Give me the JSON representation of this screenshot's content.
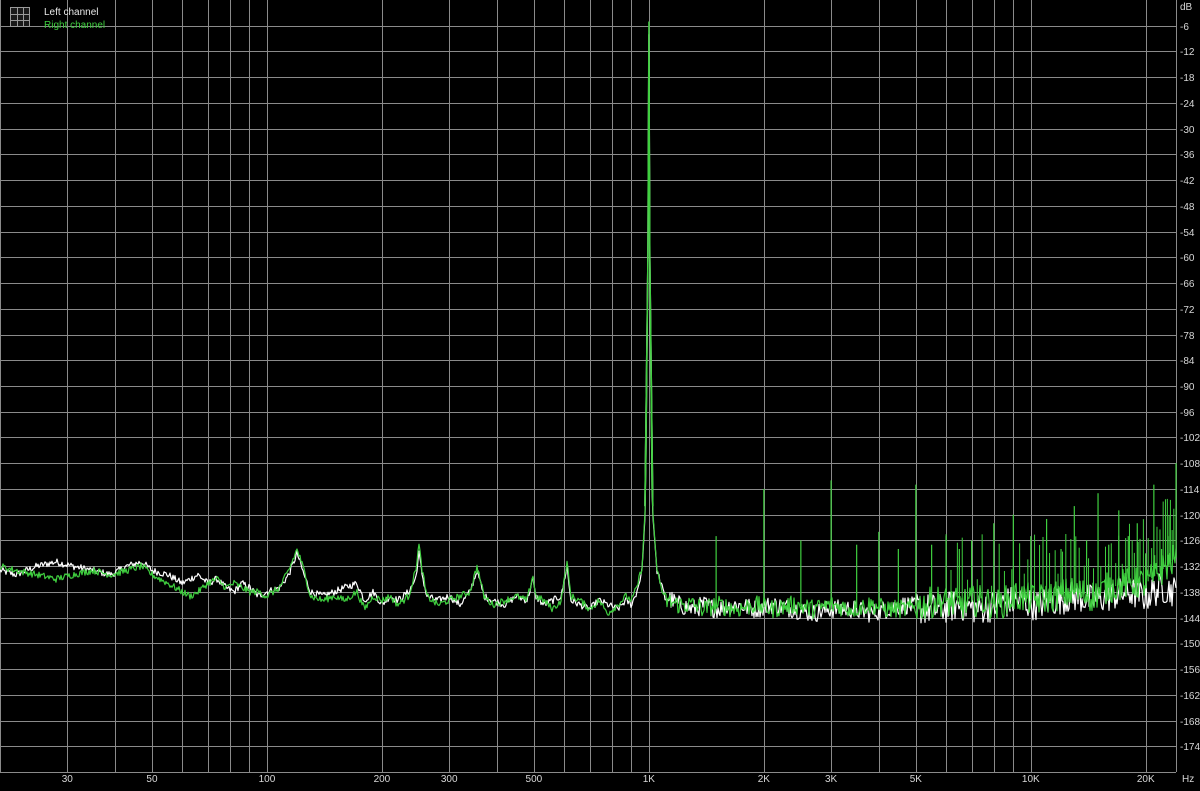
{
  "chart_data": {
    "type": "line",
    "x_scale": "log",
    "xlim": [
      20,
      24000
    ],
    "ylim": [
      -180,
      0
    ],
    "y_ticks": [
      -6,
      -12,
      -18,
      -24,
      -30,
      -36,
      -42,
      -48,
      -54,
      -60,
      -66,
      -72,
      -78,
      -84,
      -90,
      -96,
      -102,
      -108,
      -114,
      -120,
      -126,
      -132,
      -138,
      -144,
      -150,
      -156,
      -162,
      -168,
      -174
    ],
    "x_tick_values": [
      30,
      50,
      100,
      200,
      300,
      500,
      1000,
      2000,
      3000,
      5000,
      10000,
      20000
    ],
    "x_tick_labels": [
      "30",
      "50",
      "100",
      "200",
      "300",
      "500",
      "1K",
      "2K",
      "3K",
      "5K",
      "10K",
      "20K"
    ],
    "x_grid_values": [
      20,
      30,
      40,
      50,
      60,
      70,
      80,
      90,
      100,
      200,
      300,
      400,
      500,
      600,
      700,
      800,
      900,
      1000,
      2000,
      3000,
      4000,
      5000,
      6000,
      7000,
      8000,
      9000,
      10000,
      20000
    ],
    "y_unit": "dB",
    "x_unit": "Hz",
    "grid": true,
    "legend_position": "top-left",
    "background_color": "#000000",
    "grid_color": "#8a8a8a",
    "series": [
      {
        "name": "Left channel",
        "color": "#ffffff",
        "points": [
          [
            20,
            -133
          ],
          [
            22,
            -134
          ],
          [
            25,
            -132
          ],
          [
            28,
            -131
          ],
          [
            31,
            -132
          ],
          [
            35,
            -133
          ],
          [
            39,
            -134
          ],
          [
            43,
            -132
          ],
          [
            47,
            -131
          ],
          [
            50,
            -133
          ],
          [
            55,
            -134
          ],
          [
            60,
            -136
          ],
          [
            63,
            -135
          ],
          [
            66,
            -134
          ],
          [
            70,
            -136
          ],
          [
            74,
            -135
          ],
          [
            78,
            -137
          ],
          [
            82,
            -138
          ],
          [
            86,
            -136
          ],
          [
            90,
            -137
          ],
          [
            95,
            -139
          ],
          [
            100,
            -138
          ],
          [
            108,
            -137
          ],
          [
            114,
            -134
          ],
          [
            120,
            -129
          ],
          [
            125,
            -134
          ],
          [
            130,
            -138
          ],
          [
            140,
            -139
          ],
          [
            150,
            -138
          ],
          [
            160,
            -137
          ],
          [
            172,
            -136
          ],
          [
            180,
            -140
          ],
          [
            190,
            -138
          ],
          [
            200,
            -141
          ],
          [
            210,
            -139
          ],
          [
            220,
            -140
          ],
          [
            235,
            -138
          ],
          [
            245,
            -135
          ],
          [
            250,
            -129
          ],
          [
            255,
            -134
          ],
          [
            262,
            -139
          ],
          [
            280,
            -140
          ],
          [
            300,
            -139
          ],
          [
            320,
            -141
          ],
          [
            340,
            -138
          ],
          [
            355,
            -133
          ],
          [
            370,
            -139
          ],
          [
            390,
            -140
          ],
          [
            420,
            -141
          ],
          [
            450,
            -139
          ],
          [
            480,
            -140
          ],
          [
            497,
            -135
          ],
          [
            505,
            -139
          ],
          [
            530,
            -141
          ],
          [
            560,
            -140
          ],
          [
            590,
            -139
          ],
          [
            610,
            -132
          ],
          [
            625,
            -140
          ],
          [
            660,
            -141
          ],
          [
            700,
            -142
          ],
          [
            740,
            -140
          ],
          [
            780,
            -141
          ],
          [
            830,
            -142
          ],
          [
            870,
            -140
          ],
          [
            900,
            -141
          ],
          [
            930,
            -138
          ],
          [
            960,
            -133
          ],
          [
            980,
            -118
          ],
          [
            995,
            -60
          ],
          [
            1000,
            -8
          ],
          [
            1005,
            -60
          ],
          [
            1020,
            -118
          ],
          [
            1050,
            -133
          ],
          [
            1100,
            -139
          ],
          [
            1200,
            -141
          ],
          [
            1300,
            -142
          ],
          [
            1400,
            -141
          ],
          [
            1500,
            -142
          ],
          [
            1700,
            -141
          ],
          [
            1900,
            -142
          ],
          [
            2100,
            -141
          ],
          [
            2400,
            -142
          ],
          [
            2700,
            -143
          ],
          [
            3000,
            -142
          ],
          [
            3400,
            -142
          ],
          [
            3800,
            -143
          ],
          [
            4200,
            -142
          ],
          [
            4700,
            -141
          ],
          [
            5200,
            -142
          ],
          [
            5800,
            -142
          ],
          [
            6500,
            -141
          ],
          [
            7300,
            -142
          ],
          [
            8200,
            -141
          ],
          [
            9200,
            -140
          ],
          [
            10300,
            -141
          ],
          [
            11500,
            -140
          ],
          [
            13000,
            -139
          ],
          [
            14500,
            -140
          ],
          [
            16000,
            -139
          ],
          [
            18000,
            -138
          ],
          [
            20000,
            -139
          ],
          [
            22000,
            -137
          ],
          [
            24000,
            -138
          ]
        ]
      },
      {
        "name": "Right channel",
        "color": "#3fcf3f",
        "points": [
          [
            20,
            -132
          ],
          [
            22,
            -133
          ],
          [
            25,
            -134
          ],
          [
            28,
            -135
          ],
          [
            31,
            -134
          ],
          [
            35,
            -133
          ],
          [
            39,
            -134
          ],
          [
            43,
            -133
          ],
          [
            47,
            -132
          ],
          [
            50,
            -134
          ],
          [
            55,
            -136
          ],
          [
            60,
            -138
          ],
          [
            63,
            -139
          ],
          [
            66,
            -138
          ],
          [
            70,
            -136
          ],
          [
            74,
            -135
          ],
          [
            78,
            -137
          ],
          [
            82,
            -136
          ],
          [
            86,
            -137
          ],
          [
            90,
            -138
          ],
          [
            95,
            -138
          ],
          [
            100,
            -139
          ],
          [
            108,
            -137
          ],
          [
            114,
            -133
          ],
          [
            120,
            -128
          ],
          [
            125,
            -133
          ],
          [
            130,
            -139
          ],
          [
            140,
            -140
          ],
          [
            150,
            -139
          ],
          [
            160,
            -140
          ],
          [
            172,
            -138
          ],
          [
            180,
            -142
          ],
          [
            190,
            -139
          ],
          [
            200,
            -140
          ],
          [
            210,
            -139
          ],
          [
            220,
            -141
          ],
          [
            235,
            -139
          ],
          [
            245,
            -133
          ],
          [
            250,
            -127
          ],
          [
            255,
            -133
          ],
          [
            262,
            -139
          ],
          [
            280,
            -141
          ],
          [
            300,
            -140
          ],
          [
            320,
            -139
          ],
          [
            340,
            -138
          ],
          [
            355,
            -132
          ],
          [
            370,
            -139
          ],
          [
            390,
            -141
          ],
          [
            420,
            -140
          ],
          [
            450,
            -139
          ],
          [
            480,
            -140
          ],
          [
            497,
            -134
          ],
          [
            505,
            -139
          ],
          [
            530,
            -140
          ],
          [
            560,
            -142
          ],
          [
            590,
            -140
          ],
          [
            610,
            -131
          ],
          [
            625,
            -139
          ],
          [
            660,
            -140
          ],
          [
            700,
            -142
          ],
          [
            740,
            -140
          ],
          [
            780,
            -143
          ],
          [
            830,
            -141
          ],
          [
            870,
            -139
          ],
          [
            900,
            -140
          ],
          [
            930,
            -137
          ],
          [
            960,
            -132
          ],
          [
            980,
            -117
          ],
          [
            995,
            -58
          ],
          [
            1000,
            -5
          ],
          [
            1005,
            -58
          ],
          [
            1020,
            -117
          ],
          [
            1050,
            -133
          ],
          [
            1100,
            -140
          ],
          [
            1200,
            -141
          ],
          [
            1300,
            -141
          ],
          [
            1400,
            -142
          ],
          [
            1500,
            -141
          ],
          [
            1700,
            -142
          ],
          [
            1900,
            -141
          ],
          [
            2100,
            -142
          ],
          [
            2400,
            -141
          ],
          [
            2700,
            -142
          ],
          [
            3000,
            -141
          ],
          [
            3400,
            -142
          ],
          [
            3800,
            -141
          ],
          [
            4200,
            -142
          ],
          [
            4700,
            -142
          ],
          [
            5200,
            -141
          ],
          [
            5800,
            -140
          ],
          [
            6500,
            -141
          ],
          [
            7300,
            -140
          ],
          [
            8200,
            -141
          ],
          [
            9200,
            -139
          ],
          [
            10300,
            -140
          ],
          [
            11500,
            -139
          ],
          [
            13000,
            -138
          ],
          [
            14500,
            -139
          ],
          [
            16000,
            -137
          ],
          [
            18000,
            -136
          ],
          [
            20000,
            -136
          ],
          [
            22000,
            -133
          ],
          [
            24000,
            -130
          ]
        ],
        "harmonic_spikes": [
          [
            1500,
            -125
          ],
          [
            2000,
            -114
          ],
          [
            2500,
            -126
          ],
          [
            3000,
            -112
          ],
          [
            3500,
            -127
          ],
          [
            4000,
            -124
          ],
          [
            4500,
            -128
          ],
          [
            5000,
            -113
          ],
          [
            5500,
            -127
          ],
          [
            6000,
            -125
          ],
          [
            6500,
            -128
          ],
          [
            7000,
            -126
          ],
          [
            8000,
            -122
          ],
          [
            9000,
            -120
          ],
          [
            10000,
            -125
          ],
          [
            11000,
            -121
          ],
          [
            12000,
            -128
          ],
          [
            13000,
            -118
          ],
          [
            14000,
            -126
          ],
          [
            15000,
            -115
          ],
          [
            16000,
            -127
          ],
          [
            17000,
            -119
          ],
          [
            18000,
            -125
          ],
          [
            19000,
            -122
          ],
          [
            20000,
            -129
          ],
          [
            21000,
            -113
          ],
          [
            22000,
            -128
          ],
          [
            23000,
            -125
          ],
          [
            24000,
            -108
          ]
        ]
      }
    ]
  }
}
